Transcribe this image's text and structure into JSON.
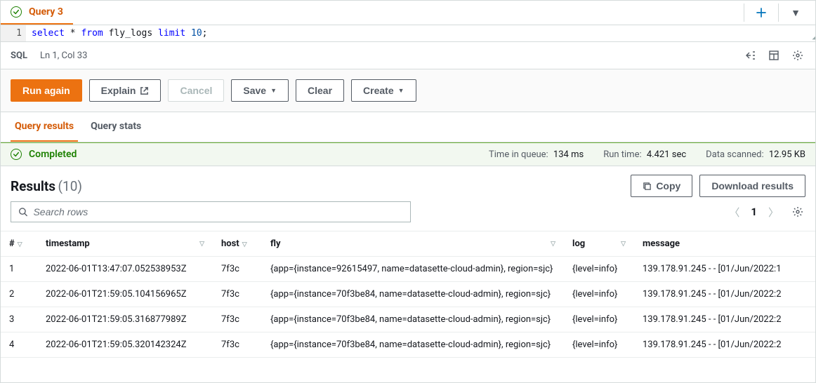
{
  "header": {
    "tab_title": "Query 3",
    "status": "success"
  },
  "editor": {
    "line_number": "1",
    "sql_raw": "select * from fly_logs limit 10;",
    "kw1": "select",
    "star": " * ",
    "kw2": "from",
    "tbl": " fly_logs ",
    "kw3": "limit",
    "num": " 10",
    "semi": ";"
  },
  "status_bar": {
    "lang": "SQL",
    "pos": "Ln 1, Col 33"
  },
  "toolbar": {
    "run": "Run again",
    "explain": "Explain",
    "cancel": "Cancel",
    "save": "Save",
    "clear": "Clear",
    "create": "Create"
  },
  "result_tabs": {
    "results": "Query results",
    "stats": "Query stats"
  },
  "completed": {
    "label": "Completed",
    "queue_label": "Time in queue:",
    "queue_value": "134 ms",
    "run_label": "Run time:",
    "run_value": "4.421 sec",
    "scan_label": "Data scanned:",
    "scan_value": "12.95 KB"
  },
  "results": {
    "title": "Results",
    "count": "(10)",
    "copy": "Copy",
    "download": "Download results",
    "search_placeholder": "Search rows",
    "page": "1"
  },
  "columns": {
    "idx": "#",
    "timestamp": "timestamp",
    "host": "host",
    "fly": "fly",
    "log": "log",
    "message": "message"
  },
  "rows": [
    {
      "idx": "1",
      "timestamp": "2022-06-01T13:47:07.052538953Z",
      "host": "7f3c",
      "fly": "{app={instance=92615497, name=datasette-cloud-admin}, region=sjc}",
      "log": "{level=info}",
      "message": "139.178.91.245 - - [01/Jun/2022:1"
    },
    {
      "idx": "2",
      "timestamp": "2022-06-01T21:59:05.104156965Z",
      "host": "7f3c",
      "fly": "{app={instance=70f3be84, name=datasette-cloud-admin}, region=sjc}",
      "log": "{level=info}",
      "message": "139.178.91.245 - - [01/Jun/2022:2"
    },
    {
      "idx": "3",
      "timestamp": "2022-06-01T21:59:05.316877989Z",
      "host": "7f3c",
      "fly": "{app={instance=70f3be84, name=datasette-cloud-admin}, region=sjc}",
      "log": "{level=info}",
      "message": "139.178.91.245 - - [01/Jun/2022:2"
    },
    {
      "idx": "4",
      "timestamp": "2022-06-01T21:59:05.320142324Z",
      "host": "7f3c",
      "fly": "{app={instance=70f3be84, name=datasette-cloud-admin}, region=sjc}",
      "log": "{level=info}",
      "message": "139.178.91.245 - - [01/Jun/2022:2"
    }
  ]
}
